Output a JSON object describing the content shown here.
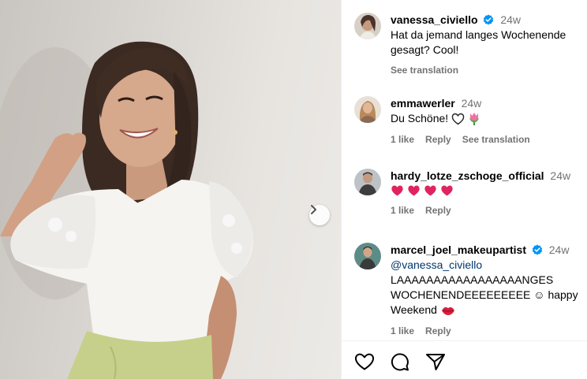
{
  "post": {
    "author": "vanessa_civiello",
    "age": "24w",
    "caption": "Hat da jemand langes Wochenende gesagt? Cool!",
    "see_translation": "See translation"
  },
  "comments": [
    {
      "user": "emmawerler",
      "age": "24w",
      "text": "Du Schöne!",
      "emoji": [
        "white-heart-icon",
        "tulip-icon"
      ],
      "likes": "1 like",
      "reply": "Reply",
      "see_translation": "See translation"
    },
    {
      "user": "hardy_lotze_zschoge_official",
      "age": "24w",
      "emoji": [
        "red-heart-icon",
        "red-heart-icon",
        "red-heart-icon",
        "red-heart-icon"
      ],
      "likes": "1 like",
      "reply": "Reply"
    },
    {
      "user": "marcel_joel_makeupartist",
      "age": "24w",
      "mention": "@vanessa_civiello",
      "text_line1": "LAAAAAAAAAAAAAAAAANGES",
      "text_line2": "WOCHENENDEEEEEEEEE ☺ happy",
      "text_line3": "Weekend",
      "emoji": [
        "lips-icon"
      ],
      "likes": "1 like",
      "reply": "Reply"
    }
  ],
  "icons": {
    "next": "chevron-right-icon",
    "like": "heart-outline-icon",
    "comment": "comment-bubble-icon",
    "share": "paper-plane-icon",
    "verified": "verified-badge-icon"
  },
  "colors": {
    "verified": "#0095f6",
    "secondary_text": "#737373",
    "mention": "#00376b",
    "heart_red": "#e0245e",
    "top_green": "#c5cf8a"
  }
}
